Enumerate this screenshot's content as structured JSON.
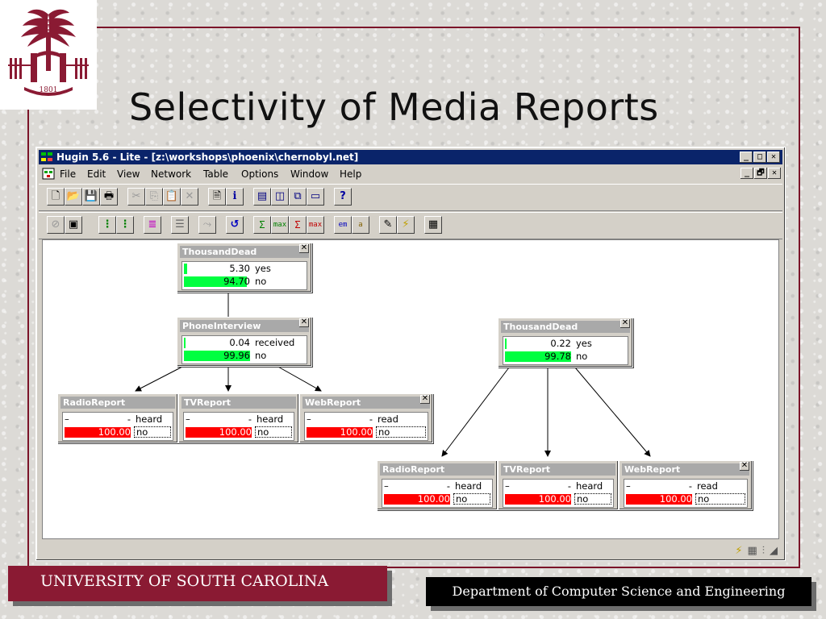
{
  "slide": {
    "title": "Selectivity of Media Reports",
    "footer_left": "UNIVERSITY OF SOUTH CAROLINA",
    "footer_right": "Department of Computer Science and Engineering",
    "accent": "#7b1429"
  },
  "window": {
    "title": "Hugin 5.6 - Lite - [z:\\workshops\\phoenix\\chernobyl.net]",
    "caption_buttons": [
      "_",
      "□",
      "✕"
    ],
    "mdi_buttons": [
      "_",
      "🗗",
      "✕"
    ]
  },
  "menu": {
    "items": [
      "File",
      "Edit",
      "View",
      "Network",
      "Table",
      "Options",
      "Window",
      "Help"
    ]
  },
  "toolbar1": {
    "icons": [
      "new-icon",
      "open-icon",
      "save-icon",
      "print-icon",
      "cut-icon",
      "copy-icon",
      "paste-icon",
      "delete-icon",
      "properties-icon",
      "info-icon",
      "layout-h-icon",
      "layout-v-icon",
      "cascade-icon",
      "window-icon",
      "help-icon"
    ],
    "glyphs": [
      "🗋",
      "📂",
      "💾",
      "🖶",
      "✂",
      "⎘",
      "📋",
      "✕",
      "🗎",
      "i",
      "▤",
      "◫",
      "⧉",
      "▭",
      "?"
    ]
  },
  "toolbar2": {
    "icons": [
      "edit-mode-icon",
      "run-mode-icon",
      "net-new-icon",
      "net-new2-icon",
      "grid-icon",
      "list-icon",
      "run-icon",
      "undo-icon",
      "sum-propagate-icon",
      "max-propagate-icon",
      "sum-propagate2-icon",
      "max-propagate2-icon",
      "em-icon",
      "a-icon",
      "pencil-icon",
      "evidence-icon",
      "report-icon"
    ],
    "glyphs": [
      "⊘",
      "▣",
      "⋮",
      "⋮",
      "≣",
      "☰",
      "⤳",
      "↺",
      "Σ",
      "max",
      "Σ",
      "max",
      "em",
      "a",
      "✎",
      "⚡",
      "▦"
    ]
  },
  "nodes": {
    "left_td": {
      "title": "ThousandDead",
      "r1_val": "5.30",
      "r1_state": "yes",
      "r1_pct": 5.3,
      "r2_val": "94.70",
      "r2_state": "no",
      "r2_pct": 94.7
    },
    "left_phone": {
      "title": "PhoneInterview",
      "r1_val": "0.04",
      "r1_state": "received",
      "r1_pct": 0.04,
      "r2_val": "99.96",
      "r2_state": "no",
      "r2_pct": 99.96
    },
    "left_radio": {
      "title": "RadioReport",
      "r1_dash": "–",
      "r1_val": "-",
      "r1_state": "heard",
      "r2_val": "100.00",
      "r2_state": "no",
      "r2_pct": 100
    },
    "left_tv": {
      "title": "TVReport",
      "r1_dash": "–",
      "r1_val": "-",
      "r1_state": "heard",
      "r2_val": "100.00",
      "r2_state": "no",
      "r2_pct": 100
    },
    "left_web": {
      "title": "WebReport",
      "r1_dash": "–",
      "r1_val": "-",
      "r1_state": "read",
      "r2_val": "100.00",
      "r2_state": "no",
      "r2_pct": 100
    },
    "right_td": {
      "title": "ThousandDead",
      "r1_val": "0.22",
      "r1_state": "yes",
      "r1_pct": 0.22,
      "r2_val": "99.78",
      "r2_state": "no",
      "r2_pct": 99.78
    },
    "right_radio": {
      "title": "RadioReport",
      "r1_dash": "–",
      "r1_val": "-",
      "r1_state": "heard",
      "r2_val": "100.00",
      "r2_state": "no",
      "r2_pct": 100
    },
    "right_tv": {
      "title": "TVReport",
      "r1_dash": "–",
      "r1_val": "-",
      "r1_state": "heard",
      "r2_val": "100.00",
      "r2_state": "no",
      "r2_pct": 100
    },
    "right_web": {
      "title": "WebReport",
      "r1_dash": "–",
      "r1_val": "-",
      "r1_state": "read",
      "r2_val": "100.00",
      "r2_state": "no",
      "r2_pct": 100
    }
  },
  "colors": {
    "belief_bar": "#00ff40",
    "evidence_bar": "#ff0000"
  },
  "statusbar": {
    "icons": [
      "evidence-icon",
      "grid-icon",
      "tree-icon"
    ]
  }
}
